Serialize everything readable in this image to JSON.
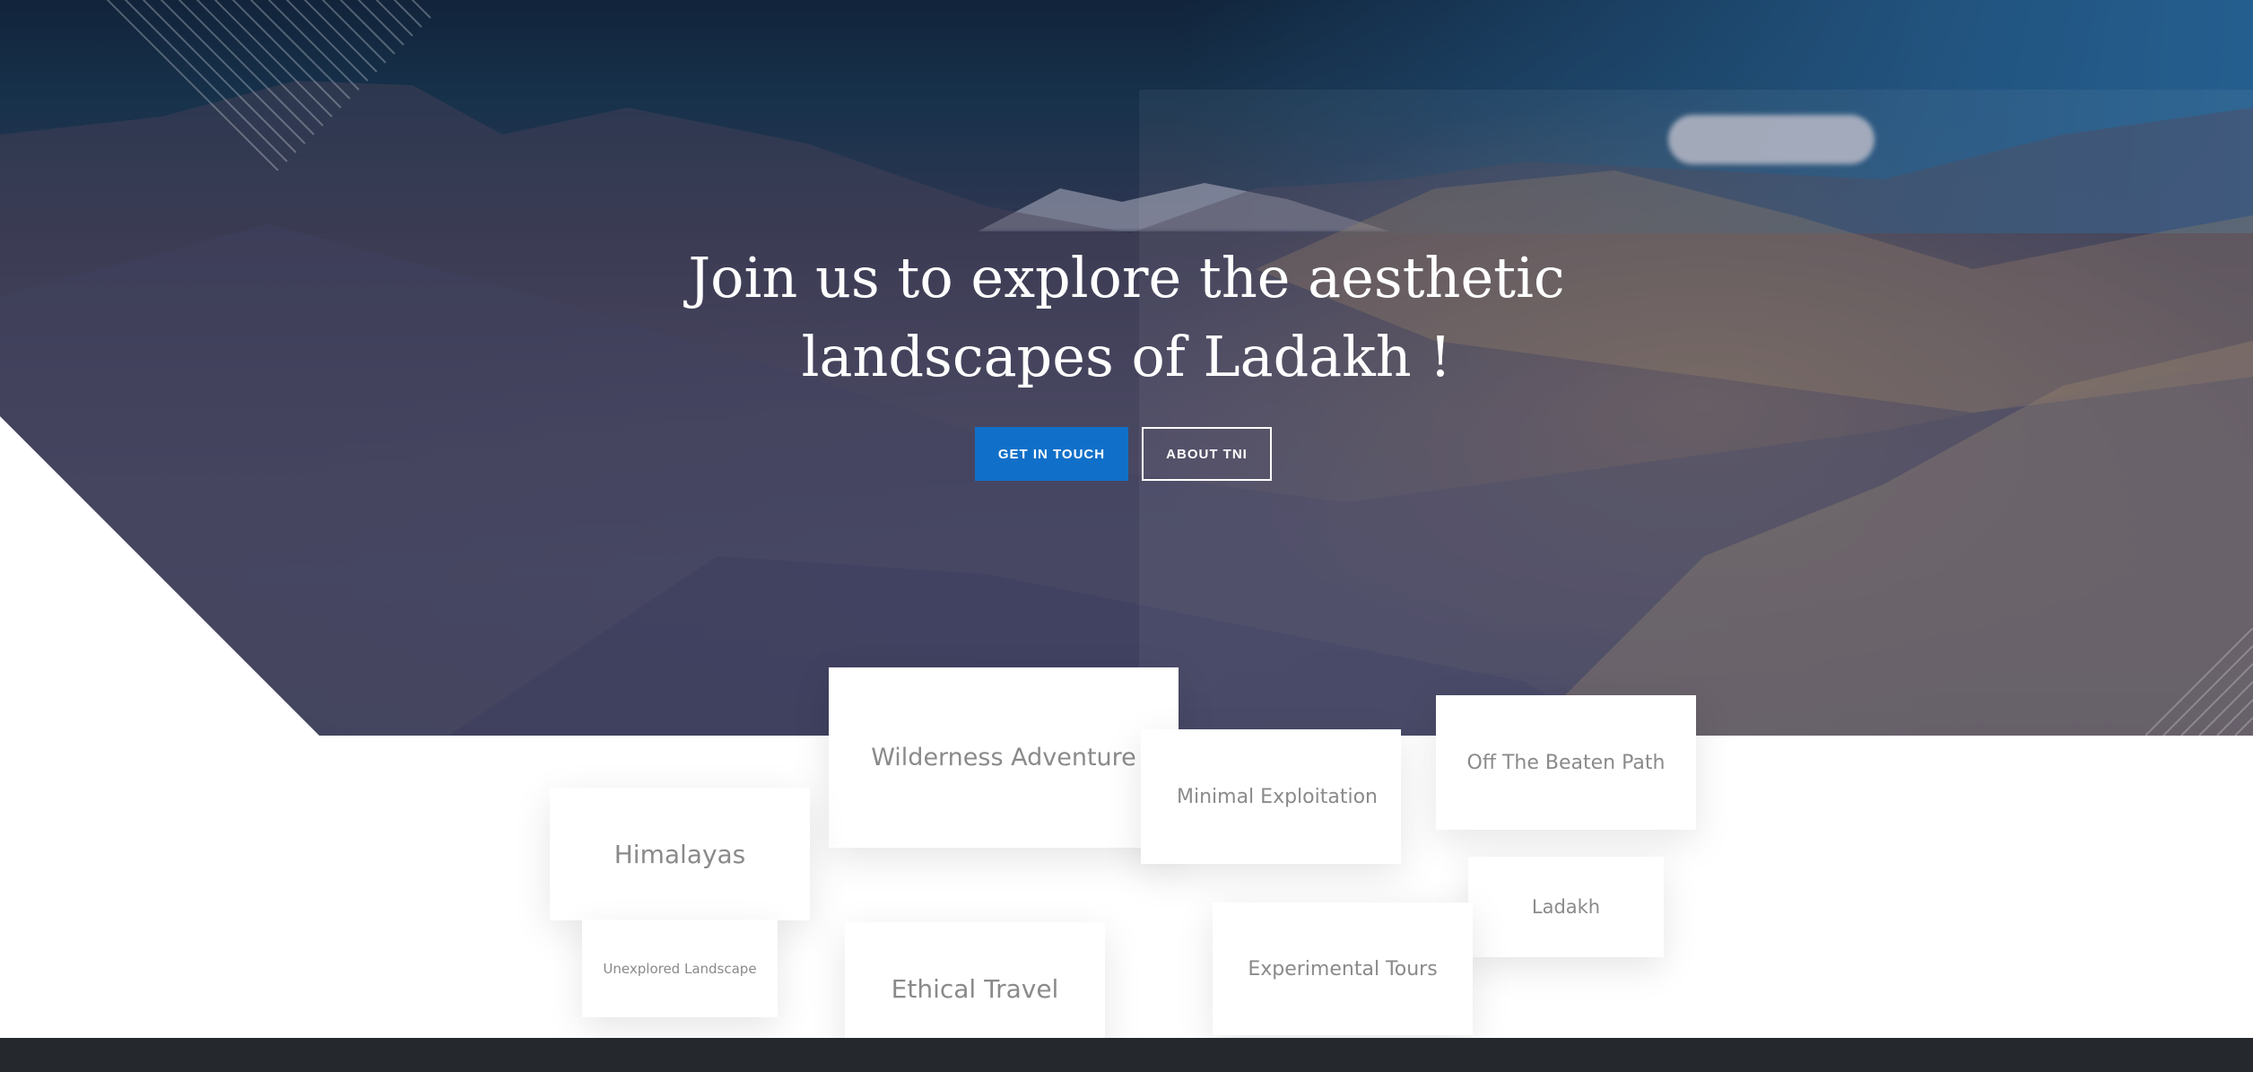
{
  "hero": {
    "title_line1": "Join us to explore the aesthetic",
    "title_line2": "landscapes of Ladakh !",
    "primary_button": "GET IN TOUCH",
    "secondary_button": "ABOUT TNI"
  },
  "tags": [
    "Wilderness Adventure",
    "Himalayas",
    "Unexplored Landscape",
    "Ethical Travel",
    "Minimal Exploitation",
    "Off The Beaten Path",
    "Ladakh",
    "Experimental Tours"
  ],
  "colors": {
    "accent": "#1070c9",
    "footer": "#25292d",
    "tag_text": "#8a8a8a"
  }
}
